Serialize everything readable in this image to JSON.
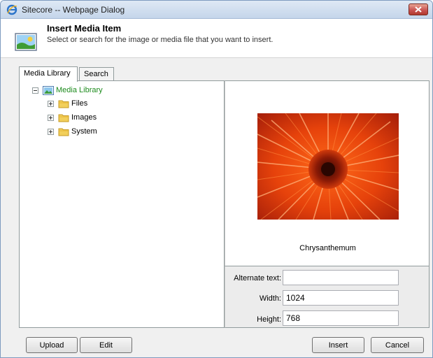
{
  "window": {
    "title": "Sitecore -- Webpage Dialog"
  },
  "header": {
    "title": "Insert Media Item",
    "subtitle": "Select or search for the image or media file that you want to insert."
  },
  "tabs": [
    {
      "label": "Media Library",
      "active": true
    },
    {
      "label": "Search",
      "active": false
    }
  ],
  "tree": {
    "root": {
      "label": "Media Library",
      "expanded": true
    },
    "children": [
      {
        "label": "Files",
        "expanded": false
      },
      {
        "label": "Images",
        "expanded": false
      },
      {
        "label": "System",
        "expanded": false
      }
    ]
  },
  "preview": {
    "caption": "Chrysanthemum"
  },
  "properties": {
    "alt_label": "Alternate text:",
    "alt_value": "",
    "width_label": "Width:",
    "width_value": "1024",
    "height_label": "Height:",
    "height_value": "768"
  },
  "buttons": {
    "upload": "Upload",
    "edit": "Edit",
    "insert": "Insert",
    "cancel": "Cancel"
  },
  "colors": {
    "titlebar": "#c4d5ea",
    "tree_root_text": "#1d8b1d",
    "close_button": "#c75050"
  },
  "icons": {
    "title": "ie-icon",
    "header": "media-image-icon",
    "close": "close-icon",
    "folder": "folder-icon"
  }
}
